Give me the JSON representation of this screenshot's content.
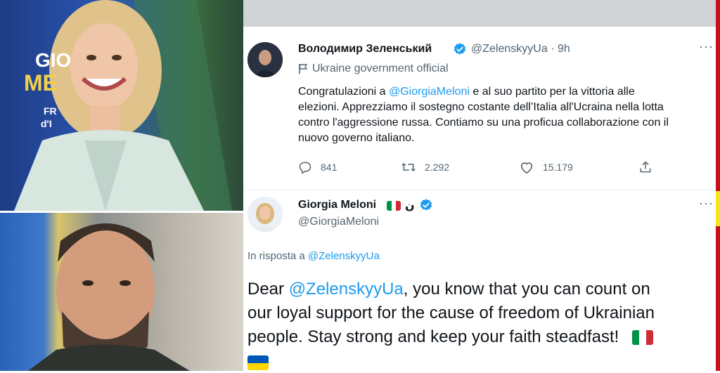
{
  "top_photo": {
    "poster_lines": [
      "GIO",
      "ME",
      "FR",
      "d'I"
    ]
  },
  "tweet1": {
    "author_name": "Володимир Зеленський",
    "handle": "@ZelenskyyUa",
    "separator": " · ",
    "time": "9h",
    "label": "Ukraine government official",
    "text_lines": [
      {
        "before": "Congratulazioni a ",
        "mention": "@GiorgiaMeloni",
        "after": " e al suo partito per la vittoria alle"
      },
      {
        "before": "elezioni. Apprezziamo il sostegno costante dell’Italia all'Ucraina nella lotta",
        "mention": "",
        "after": ""
      },
      {
        "before": "contro l'aggressione russa. Contiamo su una proficua collaborazione con il",
        "mention": "",
        "after": ""
      },
      {
        "before": "nuovo governo italiano.",
        "mention": "",
        "after": ""
      }
    ],
    "replies": "841",
    "retweets": "2.292",
    "likes": "15.179"
  },
  "tweet2": {
    "author_name": "Giorgia Meloni",
    "name_suffix": "ن",
    "handle": "@GiorgiaMeloni",
    "reply_prefix": "In risposta a ",
    "reply_to": "@ZelenskyyUa",
    "text_lines": [
      {
        "before": "Dear ",
        "mention": "@ZelenskyyUa",
        "after": ", you know that you can count on"
      },
      {
        "before": "our loyal support for the cause of freedom of Ukrainian",
        "mention": "",
        "after": ""
      },
      {
        "before": "people. Stay strong and keep your faith steadfast!",
        "mention": "",
        "after": ""
      }
    ]
  },
  "colors": {
    "accent": "#1d9bf0",
    "secondary_text": "#536471",
    "top_bar": "#cfd3d6"
  },
  "icons": [
    "verified-badge-icon",
    "more-icon",
    "government-flag-icon",
    "reply-icon",
    "retweet-icon",
    "like-icon",
    "share-icon",
    "italy-flag-icon",
    "ukraine-flag-icon"
  ]
}
